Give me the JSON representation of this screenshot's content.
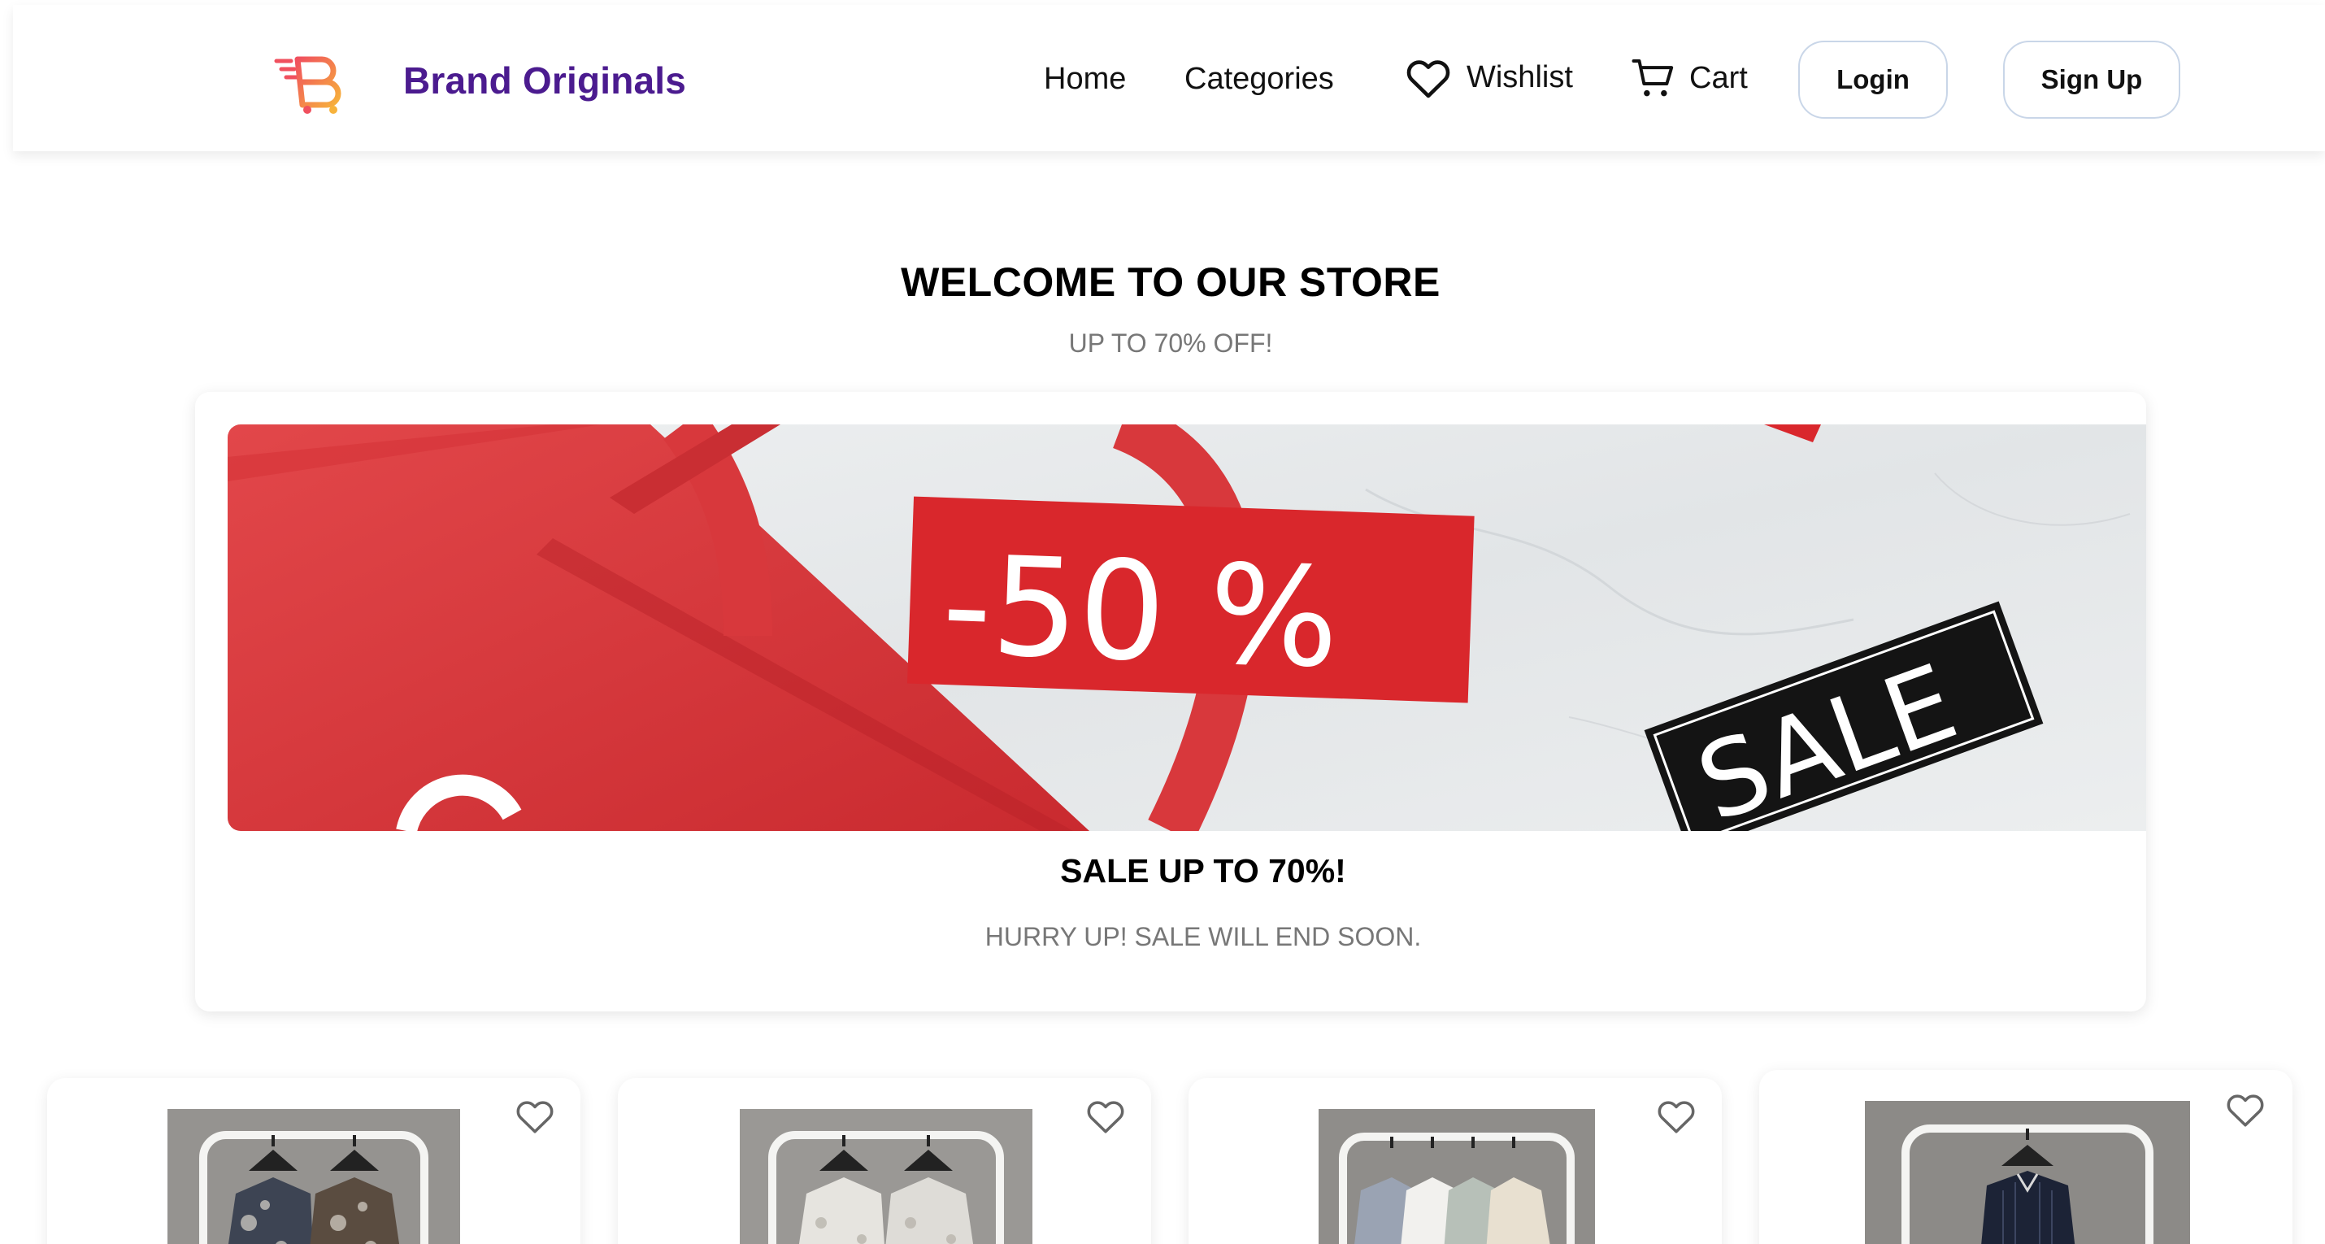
{
  "header": {
    "brand": "Brand Originals",
    "nav": {
      "home": "Home",
      "categories": "Categories",
      "wishlist": "Wishlist",
      "cart": "Cart"
    },
    "login": "Login",
    "signup": "Sign Up"
  },
  "welcome": {
    "title": "WELCOME TO OUR STORE",
    "subtitle": "UP TO 70% OFF!"
  },
  "banner": {
    "image_text_discount": "-50 %",
    "image_text_sale": "SALE",
    "title": "SALE UP TO 70%!",
    "subtitle": "HURRY UP! SALE WILL END SOON."
  },
  "products": [
    {
      "image": "shirts-on-rack-floral",
      "wishlist_icon": "heart-outline-icon"
    },
    {
      "image": "shirts-on-rack-white-print",
      "wishlist_icon": "heart-outline-icon"
    },
    {
      "image": "shirts-on-rack-pastel",
      "wishlist_icon": "heart-outline-icon"
    },
    {
      "image": "shirt-on-rack-navy-stripe",
      "wishlist_icon": "heart-outline-icon"
    }
  ],
  "colors": {
    "brand": "#4b1b8f",
    "sale_red": "#e0383c",
    "button_border": "#c9d6e8",
    "muted_text": "#777777"
  }
}
